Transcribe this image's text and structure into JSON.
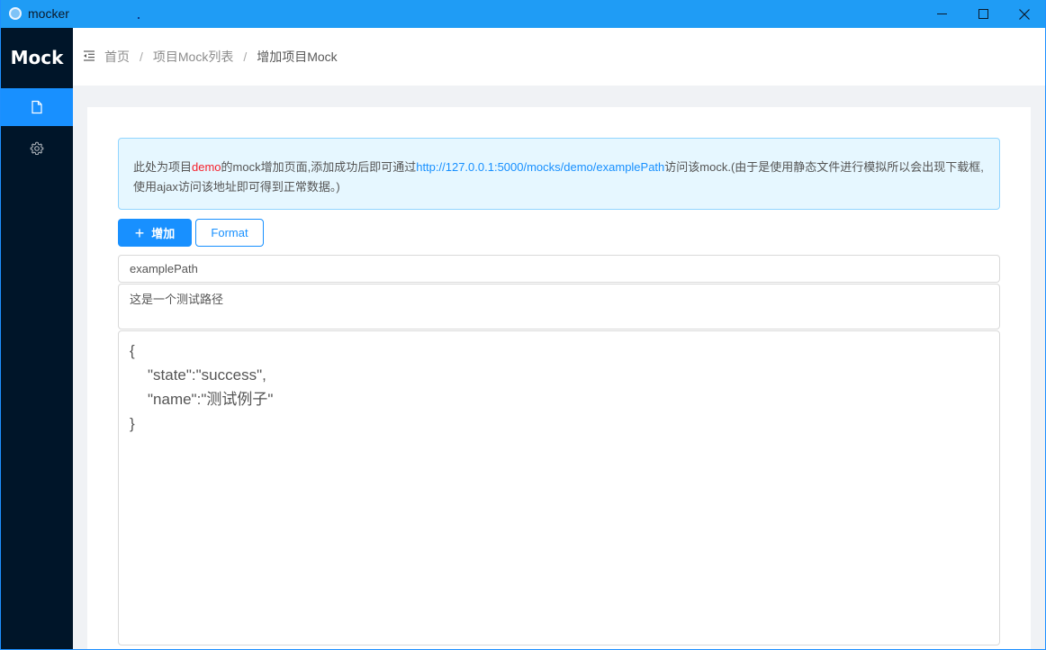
{
  "window": {
    "title": "mocker"
  },
  "sidebar": {
    "logo": "Mock",
    "items": [
      {
        "icon": "file-icon",
        "active": true
      },
      {
        "icon": "gear-icon",
        "active": false
      }
    ]
  },
  "breadcrumb": {
    "items": [
      "首页",
      "项目Mock列表",
      "增加项目Mock"
    ],
    "separator": "/"
  },
  "alert": {
    "prefix": "此处为项目",
    "project": "demo",
    "middle": "的mock增加页面,添加成功后即可通过",
    "url": "http://127.0.0.1:5000/mocks/demo/examplePath",
    "suffix": "访问该mock.(由于是使用静态文件进行模拟所以会出现下载框,使用ajax访问该地址即可得到正常数据。)"
  },
  "toolbar": {
    "add_label": "增加",
    "format_label": "Format"
  },
  "form": {
    "path_value": "examplePath",
    "description_value": "这是一个测试路径",
    "code_lines": [
      "{",
      "\"state\":\"success\",",
      "\"name\":\"测试例子\"",
      "}"
    ]
  },
  "colors": {
    "primary": "#1890ff",
    "sidebar": "#001529",
    "titlebar": "#1f9cf5",
    "highlight": "#f5222d"
  }
}
